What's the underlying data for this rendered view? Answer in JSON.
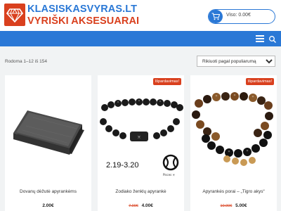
{
  "header": {
    "logo_line1": "KLASISKASVYRAS.LT",
    "logo_line2": "VYRIŠKI AKSESUARAI",
    "cart_label": "Viso: 0.00€"
  },
  "navbar": {
    "menu_icon": "hamburger-menu-icon",
    "search_icon": "search-icon"
  },
  "shop": {
    "result_count": "Rodoma 1–12 iš 154",
    "sort_selected": "Rikiuoti pagal populiarumą"
  },
  "products": [
    {
      "title": "Dovanų dėžutė apyrankėms",
      "price": "2.00€",
      "old_price": "",
      "badge": ""
    },
    {
      "title": "Zodiako ženklų apyrankė",
      "price": "4.00€",
      "old_price": "7.00€",
      "badge": "Išpardavimas!",
      "image_text": "2.19-3.20",
      "image_sign": "Pisces ♓"
    },
    {
      "title": "Apyrankės porai – „Tigro akys“",
      "price": "5.00€",
      "old_price": "10.00€",
      "badge": "Išpardavimas!"
    }
  ],
  "colors": {
    "brand_blue": "#2a78d6",
    "brand_orange": "#d9401e"
  }
}
